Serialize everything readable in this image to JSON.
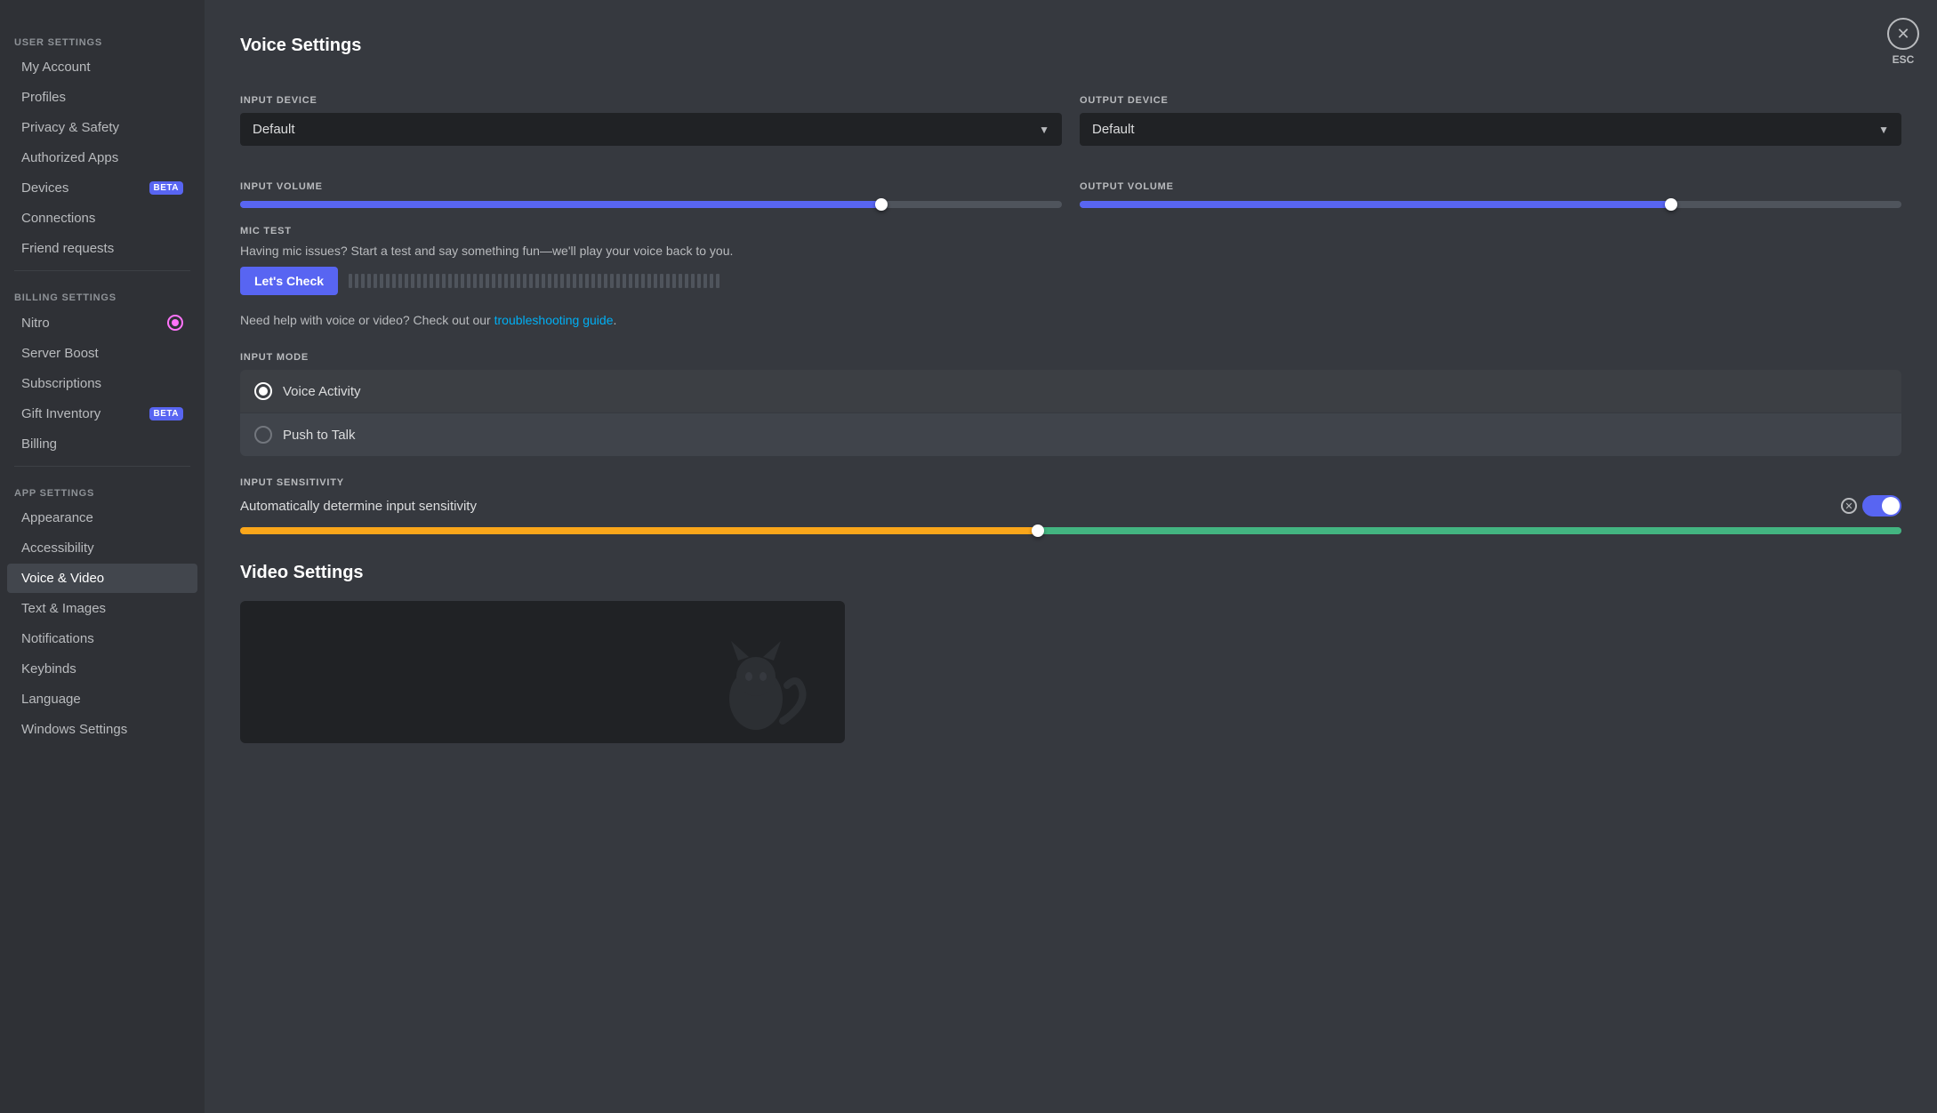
{
  "sidebar": {
    "user_settings_label": "USER SETTINGS",
    "billing_settings_label": "BILLING SETTINGS",
    "app_settings_label": "APP SETTINGS",
    "items": {
      "my_account": "My Account",
      "profiles": "Profiles",
      "privacy_safety": "Privacy & Safety",
      "authorized_apps": "Authorized Apps",
      "devices": "Devices",
      "connections": "Connections",
      "friend_requests": "Friend requests",
      "nitro": "Nitro",
      "server_boost": "Server Boost",
      "subscriptions": "Subscriptions",
      "gift_inventory": "Gift Inventory",
      "billing": "Billing",
      "appearance": "Appearance",
      "accessibility": "Accessibility",
      "voice_video": "Voice & Video",
      "text_images": "Text & Images",
      "notifications": "Notifications",
      "keybinds": "Keybinds",
      "language": "Language",
      "windows_settings": "Windows Settings"
    }
  },
  "close_button": {
    "label": "ESC"
  },
  "main": {
    "page_title": "Voice Settings",
    "input_device_label": "INPUT DEVICE",
    "input_device_value": "Default",
    "output_device_label": "OUTPUT DEVICE",
    "output_device_value": "Default",
    "input_volume_label": "INPUT VOLUME",
    "input_volume_pct": 78,
    "output_volume_label": "OUTPUT VOLUME",
    "output_volume_pct": 72,
    "mic_test_label": "MIC TEST",
    "mic_test_desc": "Having mic issues? Start a test and say something fun—we'll play your voice back to you.",
    "lets_check_btn": "Let's Check",
    "help_text": "Need help with voice or video? Check out our ",
    "troubleshooting_link": "troubleshooting guide",
    "input_mode_label": "INPUT MODE",
    "voice_activity_label": "Voice Activity",
    "push_to_talk_label": "Push to Talk",
    "input_sensitivity_label": "INPUT SENSITIVITY",
    "auto_sensitivity_label": "Automatically determine input sensitivity",
    "sensitivity_pct": 48,
    "video_settings_title": "Video Settings"
  }
}
